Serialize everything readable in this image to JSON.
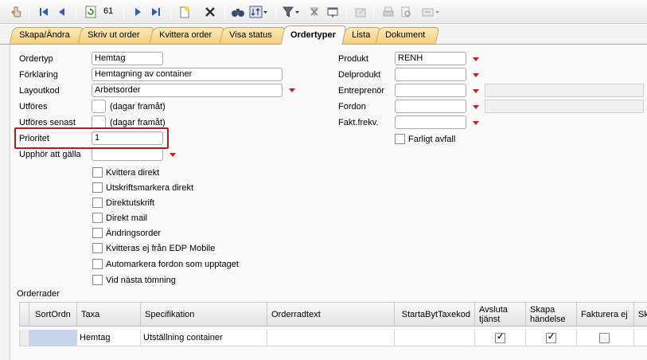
{
  "toolbar": {
    "items": [
      {
        "icon": "hand-pointer-icon"
      },
      {
        "icon": "first-record-icon"
      },
      {
        "icon": "previous-record-icon"
      },
      {
        "icon": "refresh-icon"
      },
      {
        "icon": "next-record-icon"
      },
      {
        "icon": "last-record-icon"
      },
      {
        "icon": "new-record-icon"
      },
      {
        "icon": "delete-icon"
      },
      {
        "icon": "search-binoculars-icon"
      },
      {
        "icon": "sort-icon"
      },
      {
        "icon": "filter-icon"
      },
      {
        "icon": "clear-filter-icon"
      },
      {
        "icon": "window-icon"
      },
      {
        "icon": "edit-record-icon"
      },
      {
        "icon": "print-icon"
      },
      {
        "icon": "print-preview-icon"
      },
      {
        "icon": "export-icon"
      }
    ],
    "record_count": "61"
  },
  "tabs": [
    {
      "label": "Skapa/Ändra",
      "active": false
    },
    {
      "label": "Skriv ut order",
      "active": false
    },
    {
      "label": "Kvittera order",
      "active": false
    },
    {
      "label": "Visa status",
      "active": false
    },
    {
      "label": "Ordertyper",
      "active": true
    },
    {
      "label": "Lista",
      "active": false
    },
    {
      "label": "Dokument",
      "active": false
    }
  ],
  "form": {
    "ordertyp": {
      "label": "Ordertyp",
      "value": "Hemtag"
    },
    "forklaring": {
      "label": "Förklaring",
      "value": "Hemtagning av container"
    },
    "layoutkod": {
      "label": "Layoutkod",
      "value": "Arbetsorder"
    },
    "utfores": {
      "label": "Utföres",
      "value": "",
      "suffix": "(dagar framåt)"
    },
    "utfores_senast": {
      "label": "Utföres senast",
      "value": "",
      "suffix": "(dagar framåt)"
    },
    "prioritet": {
      "label": "Prioritet",
      "value": "1"
    },
    "upphor": {
      "label": "Upphör att gälla",
      "value": ""
    },
    "produkt": {
      "label": "Produkt",
      "value": "RENH"
    },
    "delprodukt": {
      "label": "Delprodukt",
      "value": ""
    },
    "entreprenor": {
      "label": "Entreprenör",
      "value": ""
    },
    "fordon": {
      "label": "Fordon",
      "value": ""
    },
    "fakt_frekv": {
      "label": "Fakt.frekv.",
      "value": ""
    },
    "farligt_avfall": {
      "label": "Farligt avfall",
      "checked": false
    },
    "checkboxes": [
      {
        "label": "Kvittera direkt",
        "checked": false
      },
      {
        "label": "Utskriftsmarkera direkt",
        "checked": false
      },
      {
        "label": "Direktutskrift",
        "checked": false
      },
      {
        "label": "Direkt mail",
        "checked": false
      },
      {
        "label": "Ändringsorder",
        "checked": false
      },
      {
        "label": "Kvitteras ej från EDP Mobile",
        "checked": false
      },
      {
        "label": "Automarkera fordon som upptaget",
        "checked": false
      },
      {
        "label": "Vid nästa tömning",
        "checked": false
      }
    ]
  },
  "orderrader": {
    "title": "Orderrader",
    "columns": [
      "SortOrdn",
      "Taxa",
      "Specifikation",
      "Orderradtext",
      "StartaBytTaxekod",
      "Avsluta tjänst",
      "Skapa händelse",
      "Fakturera ej",
      "Sk"
    ],
    "rows": [
      {
        "sortordn": "",
        "taxa": "Hemtag",
        "specifikation": "Utställning container",
        "orderradtext": "",
        "startabyttaxekod": "",
        "avsluta_tjanst": true,
        "skapa_handelse": true,
        "fakturera_ej": false
      }
    ]
  },
  "colors": {
    "highlight": "#a5242a",
    "dropdown_arrow": "#c41f1f",
    "tab_bg": "#f6cf7e",
    "selected_cell": "#c5d4ea"
  }
}
